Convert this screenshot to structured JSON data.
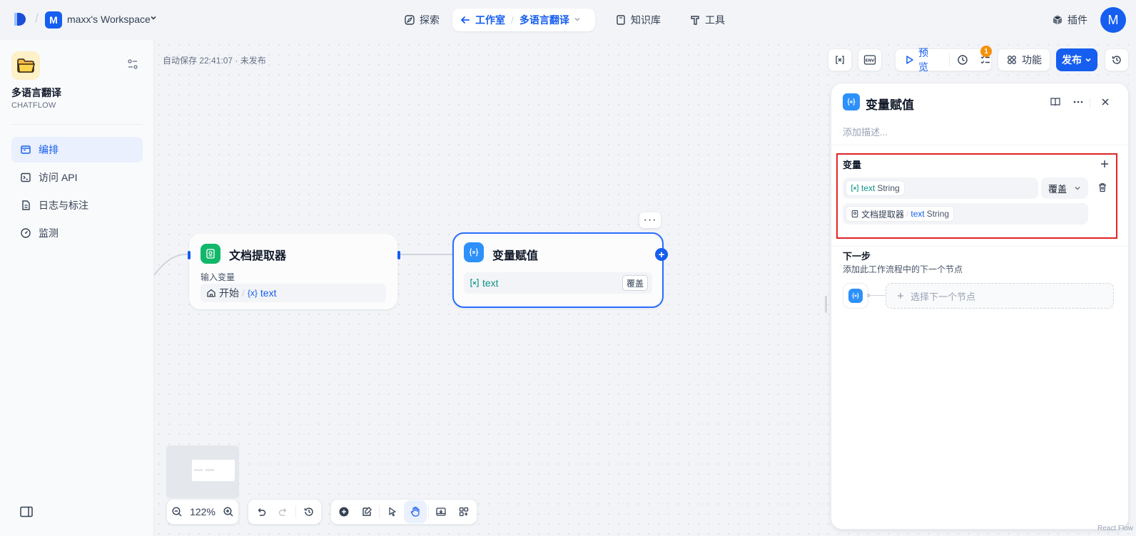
{
  "topbar": {
    "workspace_avatar": "M",
    "workspace_name": "maxx's Workspace",
    "nav": {
      "explore": "探索",
      "studio": "工作室",
      "app_crumb": "多语言翻译",
      "knowledge": "知识库",
      "tools": "工具"
    },
    "plugins": "插件",
    "user_avatar": "M"
  },
  "sidebar": {
    "app_name": "多语言翻译",
    "app_type": "CHATFLOW",
    "items": [
      {
        "label": "编排",
        "icon": "orchestrate-icon",
        "active": true
      },
      {
        "label": "访问 API",
        "icon": "terminal-icon",
        "active": false
      },
      {
        "label": "日志与标注",
        "icon": "document-icon",
        "active": false
      },
      {
        "label": "监测",
        "icon": "gauge-icon",
        "active": false
      }
    ]
  },
  "canvas": {
    "autosave": "自动保存 22:41:07 · 未发布",
    "toolbar": {
      "preview": "预览",
      "features": "功能",
      "publish": "发布",
      "checklist_count": "1",
      "env_label": "ENV"
    },
    "zoom": "122%"
  },
  "nodes": {
    "doc_extractor": {
      "title": "文档提取器",
      "input_label": "输入变量",
      "source": "开始",
      "var_prefix": "{x}",
      "var_name": "text"
    },
    "var_assign": {
      "title": "变量赋值",
      "var_name": "text",
      "mode": "覆盖"
    }
  },
  "panel": {
    "title": "变量赋值",
    "description_placeholder": "添加描述...",
    "variables_label": "变量",
    "assigned_var": "text",
    "assigned_type": "String",
    "mode": "覆盖",
    "source_node": "文档提取器",
    "source_var": "text",
    "source_type": "String",
    "next_label": "下一步",
    "next_desc": "添加此工作流程中的下一个节点",
    "next_select": "选择下一个节点"
  },
  "watermark": "React Flow",
  "colors": {
    "accent": "#155eef",
    "highlight": "#e02424",
    "teal": "#0e9384"
  }
}
